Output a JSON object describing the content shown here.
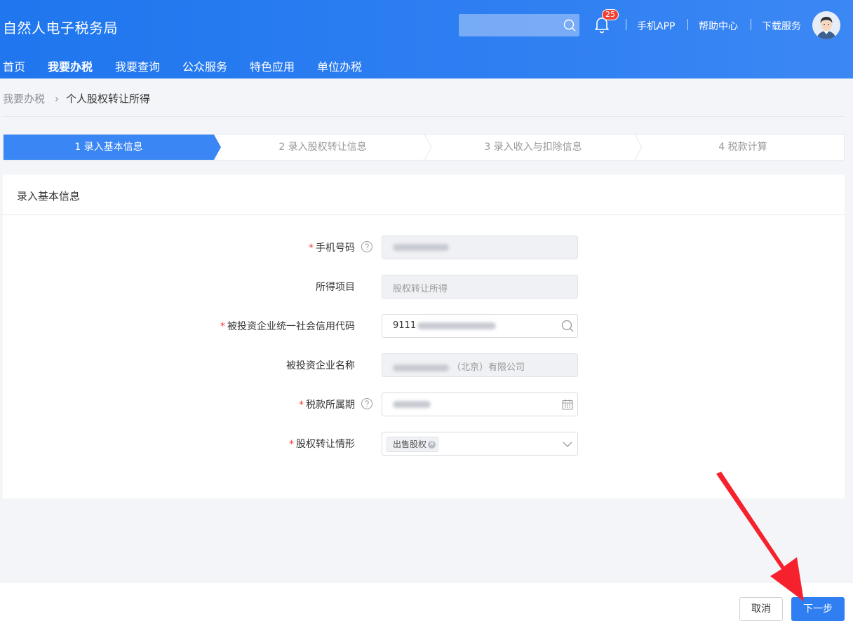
{
  "header": {
    "app_title": "自然人电子税务局",
    "search": {
      "placeholder": ""
    },
    "notification_count": "25",
    "links": [
      "手机APP",
      "帮助中心",
      "下载服务"
    ]
  },
  "nav": {
    "items": [
      "首页",
      "我要办税",
      "我要查询",
      "公众服务",
      "特色应用",
      "单位办税"
    ],
    "active": "我要办税"
  },
  "breadcrumb": {
    "parent": "我要办税",
    "current": "个人股权转让所得"
  },
  "steps": [
    {
      "label": "1  录入基本信息",
      "state": "active"
    },
    {
      "label": "2  录入股权转让信息",
      "state": "pending"
    },
    {
      "label": "3  录入收入与扣除信息",
      "state": "pending"
    },
    {
      "label": "4  税款计算",
      "state": "pending"
    }
  ],
  "form": {
    "title": "录入基本信息",
    "fields": {
      "phone": {
        "label": "手机号码",
        "required": true,
        "value_redacted": true
      },
      "income_item": {
        "label": "所得项目",
        "value": "股权转让所得"
      },
      "credit_code": {
        "label": "被投资企业统一社会信用代码",
        "required": true,
        "value_prefix": "9111"
      },
      "company_name": {
        "label": "被投资企业名称",
        "value_suffix": "（北京）有限公司"
      },
      "tax_period": {
        "label": "税款所属期",
        "required": true,
        "value_redacted": true
      },
      "transfer_type": {
        "label": "股权转让情形",
        "required": true,
        "tag": "出售股权"
      }
    },
    "required_mark": "*"
  },
  "footer": {
    "cancel_label": "取消",
    "next_label": "下一步"
  },
  "colors": {
    "primary": "#2f7ff2",
    "required": "#f04134",
    "annotation_arrow": "#f5222d"
  }
}
